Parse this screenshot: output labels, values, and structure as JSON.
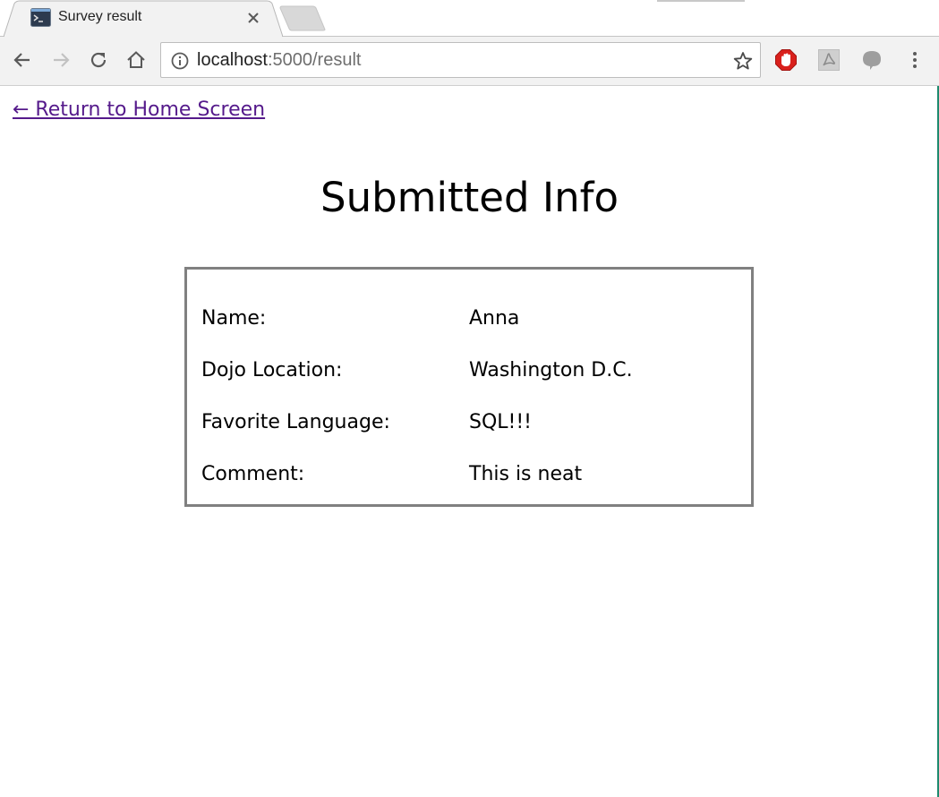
{
  "browser": {
    "tab": {
      "title": "Survey result"
    },
    "address_bar": {
      "host": "localhost",
      "path": ":5000/result"
    },
    "colors": {
      "visited_link": "#551a8b",
      "box_border": "#808080",
      "toolbar_bg": "#f2f2f2",
      "adblock_red": "#d9201c"
    },
    "icons": {
      "favicon": "terminal-favicon-icon",
      "close": "close-icon",
      "back": "back-arrow-icon",
      "forward": "forward-arrow-icon",
      "reload": "reload-icon",
      "home": "home-icon",
      "info": "info-icon",
      "bookmark": "star-icon",
      "adblock": "adblock-icon",
      "pdf": "pdf-extension-icon",
      "chat": "chat-bubble-icon",
      "menu": "kebab-menu-icon"
    }
  },
  "page": {
    "home_link": "← Return to Home Screen",
    "title": "Submitted Info",
    "rows": [
      {
        "label": "Name:",
        "value": "Anna"
      },
      {
        "label": "Dojo Location:",
        "value": "Washington D.C."
      },
      {
        "label": "Favorite Language:",
        "value": "SQL!!!"
      },
      {
        "label": "Comment:",
        "value": "This is neat"
      }
    ]
  }
}
